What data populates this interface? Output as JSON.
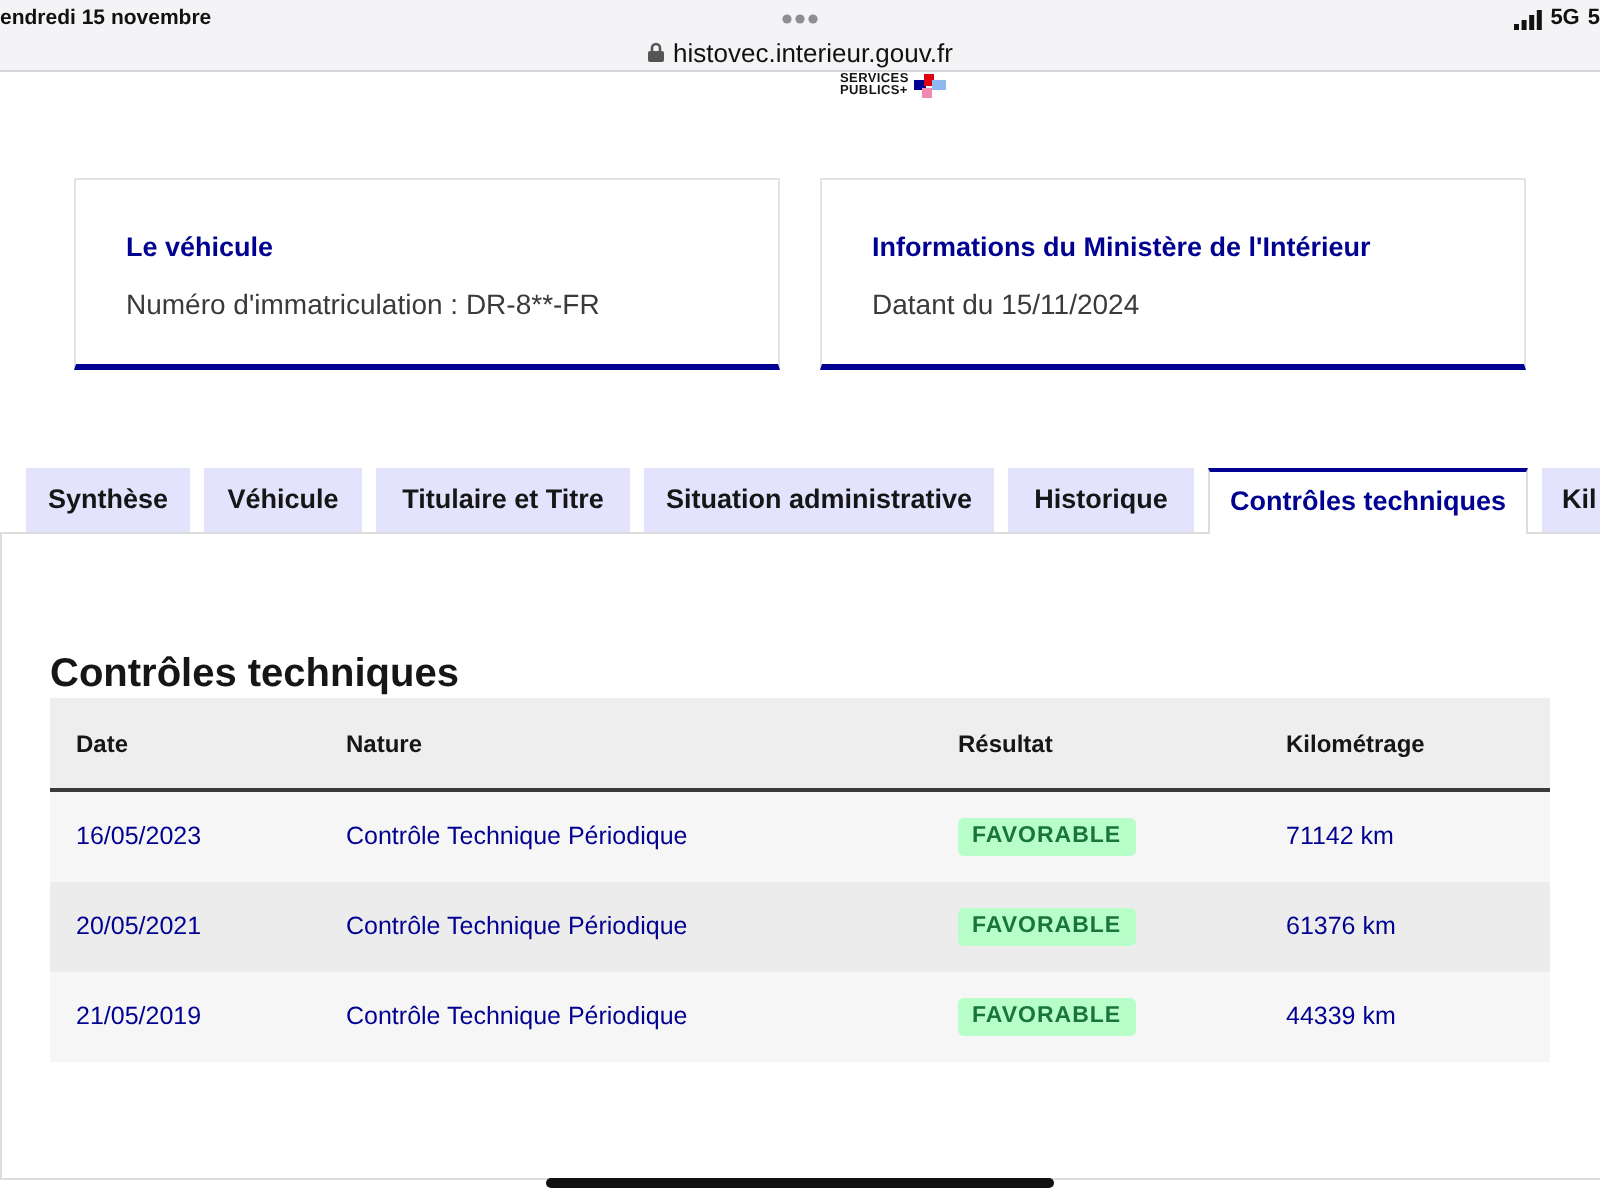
{
  "status_bar": {
    "date": "endredi 15 novembre",
    "url": "histovec.interieur.gouv.fr",
    "network": "5G",
    "battery": "5"
  },
  "logo": {
    "lines": [
      "SERVICES",
      "PUBLICS+"
    ]
  },
  "cards": [
    {
      "title": "Le véhicule",
      "text": "Numéro d'immatriculation : DR-8**-FR"
    },
    {
      "title": "Informations du Ministère de l'Intérieur",
      "text": "Datant du 15/11/2024"
    }
  ],
  "tabs": [
    {
      "label": "Synthèse",
      "selected": false
    },
    {
      "label": "Véhicule",
      "selected": false
    },
    {
      "label": "Titulaire et Titre",
      "selected": false
    },
    {
      "label": "Situation administrative",
      "selected": false
    },
    {
      "label": "Historique",
      "selected": false
    },
    {
      "label": "Contrôles techniques",
      "selected": true
    },
    {
      "label": "Kil",
      "selected": false
    }
  ],
  "section": {
    "title": "Contrôles techniques",
    "table": {
      "columns": [
        "Date",
        "Nature",
        "Résultat",
        "Kilométrage"
      ],
      "rows": [
        {
          "date": "16/05/2023",
          "nature": "Contrôle Technique Périodique",
          "result": "FAVORABLE",
          "mileage": "71142 km"
        },
        {
          "date": "20/05/2021",
          "nature": "Contrôle Technique Périodique",
          "result": "FAVORABLE",
          "mileage": "61376 km"
        },
        {
          "date": "21/05/2019",
          "nature": "Contrôle Technique Périodique",
          "result": "FAVORABLE",
          "mileage": "44339 km"
        }
      ]
    }
  }
}
